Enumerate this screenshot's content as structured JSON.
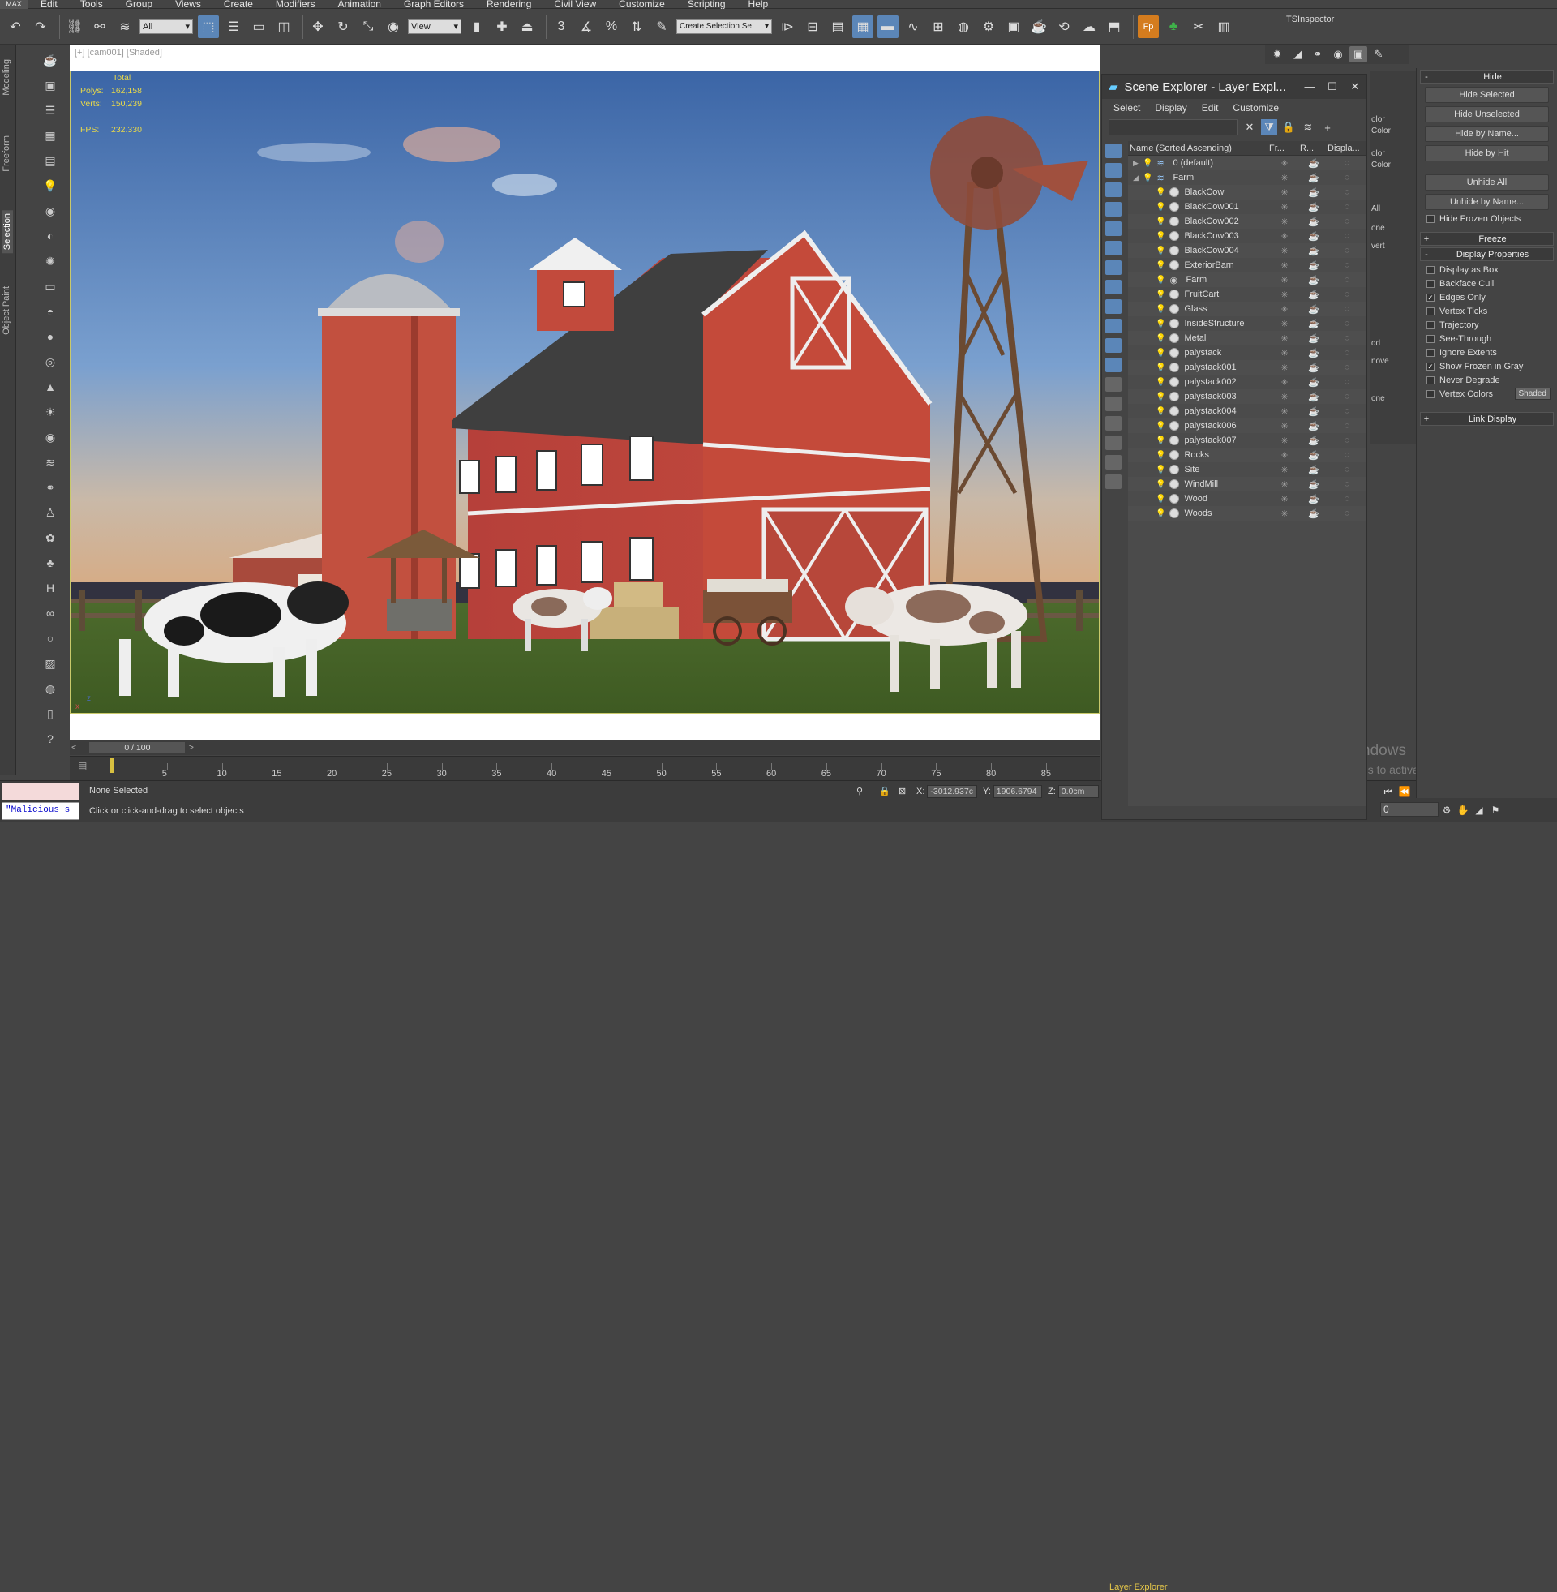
{
  "menubar": {
    "logo": "MAX",
    "items": [
      "Edit",
      "Tools",
      "Group",
      "Views",
      "Create",
      "Modifiers",
      "Animation",
      "Graph Editors",
      "Rendering",
      "Civil View",
      "Customize",
      "Scripting",
      "Help"
    ]
  },
  "toolbar": {
    "filter_select": "All",
    "ref_coord_select": "View",
    "selection_set": "Create Selection Se",
    "plugin_label": "TSInspector",
    "fp_label": "Fp"
  },
  "left_ribbon": {
    "tabs": [
      "Modeling",
      "Freeform",
      "Selection",
      "Object Paint"
    ],
    "active": "Selection"
  },
  "viewport": {
    "label": "[+] [cam001] [Shaded]",
    "stats_header": "Total",
    "polys_label": "Polys:",
    "polys_value": "162,158",
    "verts_label": "Verts:",
    "verts_value": "150,239",
    "fps_label": "FPS:",
    "fps_value": "232.330",
    "axis_label": "z",
    "axis_x": "x"
  },
  "timeline": {
    "frame_display": "0 / 100",
    "ticks": [
      "5",
      "10",
      "15",
      "20",
      "25",
      "30",
      "35",
      "40",
      "45",
      "50",
      "55",
      "60",
      "65",
      "70",
      "75",
      "80",
      "85"
    ]
  },
  "status": {
    "maxscript_text": "\"Malicious s",
    "selection_status": "None Selected",
    "prompt": "Click or click-and-drag to select objects",
    "x_label": "X:",
    "x_value": "-3012.937c",
    "y_label": "Y:",
    "y_value": "1906.6794",
    "z_label": "Z:",
    "z_value": "0.0cm",
    "layer_explorer": "Layer Explorer",
    "frame_spinner": "0"
  },
  "windows_notice": {
    "title": "Activate Windows",
    "subtitle": "Go to PC settings to activate Windows."
  },
  "scene_explorer": {
    "title": "Scene Explorer - Layer Expl...",
    "menu": [
      "Select",
      "Display",
      "Edit",
      "Customize"
    ],
    "columns": [
      "Name (Sorted Ascending)",
      "Fr...",
      "R...",
      "Displa..."
    ],
    "layers": [
      {
        "name": "0 (default)",
        "type": "layer",
        "indent": 0,
        "expand": "closed"
      },
      {
        "name": "Farm",
        "type": "layer",
        "indent": 0,
        "expand": "open"
      },
      {
        "name": "BlackCow",
        "type": "geo",
        "indent": 1
      },
      {
        "name": "BlackCow001",
        "type": "geo",
        "indent": 1
      },
      {
        "name": "BlackCow002",
        "type": "geo",
        "indent": 1
      },
      {
        "name": "BlackCow003",
        "type": "geo",
        "indent": 1
      },
      {
        "name": "BlackCow004",
        "type": "geo",
        "indent": 1
      },
      {
        "name": "ExteriorBarn",
        "type": "geo",
        "indent": 1
      },
      {
        "name": "Farm",
        "type": "camera",
        "indent": 1
      },
      {
        "name": "FruitCart",
        "type": "geo",
        "indent": 1
      },
      {
        "name": "Glass",
        "type": "geo",
        "indent": 1
      },
      {
        "name": "InsideStructure",
        "type": "geo",
        "indent": 1
      },
      {
        "name": "Metal",
        "type": "geo",
        "indent": 1
      },
      {
        "name": "palystack",
        "type": "geo",
        "indent": 1
      },
      {
        "name": "palystack001",
        "type": "geo",
        "indent": 1
      },
      {
        "name": "palystack002",
        "type": "geo",
        "indent": 1
      },
      {
        "name": "palystack003",
        "type": "geo",
        "indent": 1
      },
      {
        "name": "palystack004",
        "type": "geo",
        "indent": 1
      },
      {
        "name": "palystack006",
        "type": "geo",
        "indent": 1
      },
      {
        "name": "palystack007",
        "type": "geo",
        "indent": 1
      },
      {
        "name": "Rocks",
        "type": "geo",
        "indent": 1
      },
      {
        "name": "Site",
        "type": "geo",
        "indent": 1
      },
      {
        "name": "WindMill",
        "type": "geo",
        "indent": 1
      },
      {
        "name": "Wood",
        "type": "geo",
        "indent": 1
      },
      {
        "name": "Woods",
        "type": "geo",
        "indent": 1
      }
    ]
  },
  "partial_panel": {
    "lines": [
      "olor",
      "Color",
      "olor",
      "Color",
      "All",
      "one",
      "vert",
      "dd",
      "nove",
      "one"
    ]
  },
  "command_panel": {
    "hide_rollout": "Hide",
    "hide_buttons": [
      "Hide Selected",
      "Hide Unselected",
      "Hide by Name...",
      "Hide by Hit"
    ],
    "unhide_buttons": [
      "Unhide All",
      "Unhide by Name..."
    ],
    "hide_frozen": "Hide Frozen Objects",
    "freeze_rollout": "Freeze",
    "display_props_rollout": "Display Properties",
    "display_props": [
      {
        "label": "Display as Box",
        "checked": false
      },
      {
        "label": "Backface Cull",
        "checked": false
      },
      {
        "label": "Edges Only",
        "checked": true
      },
      {
        "label": "Vertex Ticks",
        "checked": false
      },
      {
        "label": "Trajectory",
        "checked": false
      },
      {
        "label": "See-Through",
        "checked": false
      },
      {
        "label": "Ignore Extents",
        "checked": false
      },
      {
        "label": "Show Frozen in Gray",
        "checked": true
      },
      {
        "label": "Never Degrade",
        "checked": false
      },
      {
        "label": "Vertex Colors",
        "checked": false
      }
    ],
    "shaded_button": "Shaded",
    "link_display_rollout": "Link Display"
  },
  "colors": {
    "accent": "#5b86b8",
    "stats_text": "#e8d84a",
    "layer_explorer_text": "#e6c84a",
    "pink_swatch": "#d03a8a"
  }
}
